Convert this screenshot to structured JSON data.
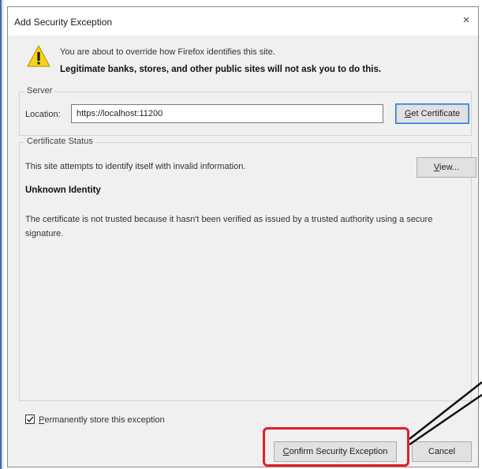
{
  "dialog": {
    "title": "Add Security Exception",
    "close_glyph": "×"
  },
  "warning": {
    "icon": "warning-triangle-icon",
    "line1": "You are about to override how Firefox identifies this site.",
    "line2": "Legitimate banks, stores, and other public sites will not ask you to do this."
  },
  "server": {
    "group_label": "Server",
    "location_label": "Location:",
    "location_value": "https://localhost:11200",
    "get_certificate_label": "et Certificate",
    "get_certificate_accesskey": "G"
  },
  "certificate_status": {
    "group_label": "Certificate Status",
    "status_text": "This site attempts to identify itself with invalid information.",
    "view_label": "iew...",
    "view_accesskey": "V",
    "unknown_identity": "Unknown Identity",
    "description": "The certificate is not trusted because it hasn't been verified as issued by a trusted authority using a secure signature."
  },
  "options": {
    "permanent_label": "ermanently store this exception",
    "permanent_accesskey": "P",
    "permanent_checked": true
  },
  "buttons": {
    "confirm_label": "onfirm Security Exception",
    "confirm_accesskey": "C",
    "cancel_label": "Cancel"
  },
  "annotation": {
    "highlight_color": "#e0202a"
  }
}
